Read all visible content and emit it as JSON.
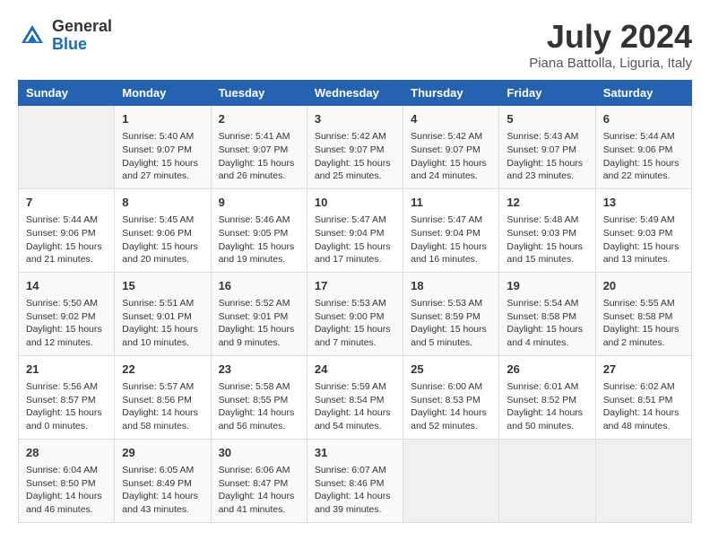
{
  "header": {
    "logo_general": "General",
    "logo_blue": "Blue",
    "month_title": "July 2024",
    "location": "Piana Battolla, Liguria, Italy"
  },
  "days_of_week": [
    "Sunday",
    "Monday",
    "Tuesday",
    "Wednesday",
    "Thursday",
    "Friday",
    "Saturday"
  ],
  "weeks": [
    [
      {
        "num": "",
        "info": ""
      },
      {
        "num": "1",
        "info": "Sunrise: 5:40 AM\nSunset: 9:07 PM\nDaylight: 15 hours\nand 27 minutes."
      },
      {
        "num": "2",
        "info": "Sunrise: 5:41 AM\nSunset: 9:07 PM\nDaylight: 15 hours\nand 26 minutes."
      },
      {
        "num": "3",
        "info": "Sunrise: 5:42 AM\nSunset: 9:07 PM\nDaylight: 15 hours\nand 25 minutes."
      },
      {
        "num": "4",
        "info": "Sunrise: 5:42 AM\nSunset: 9:07 PM\nDaylight: 15 hours\nand 24 minutes."
      },
      {
        "num": "5",
        "info": "Sunrise: 5:43 AM\nSunset: 9:07 PM\nDaylight: 15 hours\nand 23 minutes."
      },
      {
        "num": "6",
        "info": "Sunrise: 5:44 AM\nSunset: 9:06 PM\nDaylight: 15 hours\nand 22 minutes."
      }
    ],
    [
      {
        "num": "7",
        "info": "Sunrise: 5:44 AM\nSunset: 9:06 PM\nDaylight: 15 hours\nand 21 minutes."
      },
      {
        "num": "8",
        "info": "Sunrise: 5:45 AM\nSunset: 9:06 PM\nDaylight: 15 hours\nand 20 minutes."
      },
      {
        "num": "9",
        "info": "Sunrise: 5:46 AM\nSunset: 9:05 PM\nDaylight: 15 hours\nand 19 minutes."
      },
      {
        "num": "10",
        "info": "Sunrise: 5:47 AM\nSunset: 9:04 PM\nDaylight: 15 hours\nand 17 minutes."
      },
      {
        "num": "11",
        "info": "Sunrise: 5:47 AM\nSunset: 9:04 PM\nDaylight: 15 hours\nand 16 minutes."
      },
      {
        "num": "12",
        "info": "Sunrise: 5:48 AM\nSunset: 9:03 PM\nDaylight: 15 hours\nand 15 minutes."
      },
      {
        "num": "13",
        "info": "Sunrise: 5:49 AM\nSunset: 9:03 PM\nDaylight: 15 hours\nand 13 minutes."
      }
    ],
    [
      {
        "num": "14",
        "info": "Sunrise: 5:50 AM\nSunset: 9:02 PM\nDaylight: 15 hours\nand 12 minutes."
      },
      {
        "num": "15",
        "info": "Sunrise: 5:51 AM\nSunset: 9:01 PM\nDaylight: 15 hours\nand 10 minutes."
      },
      {
        "num": "16",
        "info": "Sunrise: 5:52 AM\nSunset: 9:01 PM\nDaylight: 15 hours\nand 9 minutes."
      },
      {
        "num": "17",
        "info": "Sunrise: 5:53 AM\nSunset: 9:00 PM\nDaylight: 15 hours\nand 7 minutes."
      },
      {
        "num": "18",
        "info": "Sunrise: 5:53 AM\nSunset: 8:59 PM\nDaylight: 15 hours\nand 5 minutes."
      },
      {
        "num": "19",
        "info": "Sunrise: 5:54 AM\nSunset: 8:58 PM\nDaylight: 15 hours\nand 4 minutes."
      },
      {
        "num": "20",
        "info": "Sunrise: 5:55 AM\nSunset: 8:58 PM\nDaylight: 15 hours\nand 2 minutes."
      }
    ],
    [
      {
        "num": "21",
        "info": "Sunrise: 5:56 AM\nSunset: 8:57 PM\nDaylight: 15 hours\nand 0 minutes."
      },
      {
        "num": "22",
        "info": "Sunrise: 5:57 AM\nSunset: 8:56 PM\nDaylight: 14 hours\nand 58 minutes."
      },
      {
        "num": "23",
        "info": "Sunrise: 5:58 AM\nSunset: 8:55 PM\nDaylight: 14 hours\nand 56 minutes."
      },
      {
        "num": "24",
        "info": "Sunrise: 5:59 AM\nSunset: 8:54 PM\nDaylight: 14 hours\nand 54 minutes."
      },
      {
        "num": "25",
        "info": "Sunrise: 6:00 AM\nSunset: 8:53 PM\nDaylight: 14 hours\nand 52 minutes."
      },
      {
        "num": "26",
        "info": "Sunrise: 6:01 AM\nSunset: 8:52 PM\nDaylight: 14 hours\nand 50 minutes."
      },
      {
        "num": "27",
        "info": "Sunrise: 6:02 AM\nSunset: 8:51 PM\nDaylight: 14 hours\nand 48 minutes."
      }
    ],
    [
      {
        "num": "28",
        "info": "Sunrise: 6:04 AM\nSunset: 8:50 PM\nDaylight: 14 hours\nand 46 minutes."
      },
      {
        "num": "29",
        "info": "Sunrise: 6:05 AM\nSunset: 8:49 PM\nDaylight: 14 hours\nand 43 minutes."
      },
      {
        "num": "30",
        "info": "Sunrise: 6:06 AM\nSunset: 8:47 PM\nDaylight: 14 hours\nand 41 minutes."
      },
      {
        "num": "31",
        "info": "Sunrise: 6:07 AM\nSunset: 8:46 PM\nDaylight: 14 hours\nand 39 minutes."
      },
      {
        "num": "",
        "info": ""
      },
      {
        "num": "",
        "info": ""
      },
      {
        "num": "",
        "info": ""
      }
    ]
  ]
}
